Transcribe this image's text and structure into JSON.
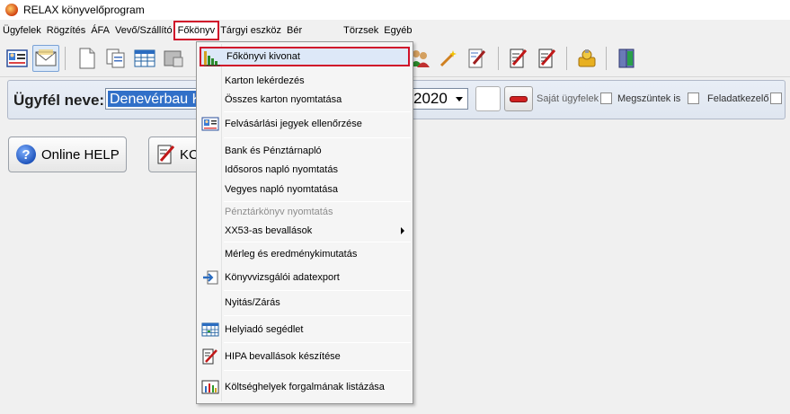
{
  "window": {
    "title": "RELAX könyvelőprogram"
  },
  "menubar": {
    "items": [
      {
        "label": "Ügyfelek"
      },
      {
        "label": "Rögzítés"
      },
      {
        "label": "ÁFA"
      },
      {
        "label": "Vevő/Szállító"
      },
      {
        "label": "Főkönyv"
      },
      {
        "label": "Tárgyi eszköz"
      },
      {
        "label": "Bér"
      },
      {
        "label": "Törzsek"
      },
      {
        "label": "Egyéb"
      }
    ]
  },
  "client_panel": {
    "label": "Ügyfél neve:",
    "client_value": "Denevérbau Kft",
    "year_value": "2020",
    "options": [
      {
        "label": "Saját ügyfelek",
        "checked": false
      },
      {
        "label": "Megszüntek is",
        "checked": false
      },
      {
        "label": "Feladatkezelő",
        "checked": false
      }
    ]
  },
  "buttons": {
    "help_label": "Online HELP",
    "kc_label": "KC"
  },
  "dropdown": {
    "items": [
      {
        "label": "Főkönyvi kivonat",
        "icon": "ledger-chart-icon",
        "highlighted": true
      },
      {
        "label": "Karton lekérdezés"
      },
      {
        "label": "Összes karton nyomtatása"
      },
      {
        "label": "Felvásárlási jegyek ellenőrzése",
        "icon": "id-card-icon"
      },
      {
        "label": "Bank és Pénztárnapló"
      },
      {
        "label": "Idősoros napló nyomtatás"
      },
      {
        "label": "Vegyes napló nyomtatása"
      },
      {
        "label": "Pénztárkönyv nyomtatás",
        "disabled": true
      },
      {
        "label": "XX53-as bevallások",
        "submenu": true
      },
      {
        "label": "Mérleg és eredménykimutatás"
      },
      {
        "label": "Könyvvizsgálói adatexport",
        "icon": "export-icon"
      },
      {
        "label": "Nyitás/Zárás"
      },
      {
        "label": "Helyiadó segédlet",
        "icon": "calendar-grid-icon"
      },
      {
        "label": "HIPA bevallások készítése",
        "icon": "form-edit-icon"
      },
      {
        "label": "Költséghelyek forgalmának listázása",
        "icon": "bar-chart-icon"
      }
    ]
  },
  "colors": {
    "highlight_border": "#d0102a",
    "selection_blue": "#3170c8"
  }
}
